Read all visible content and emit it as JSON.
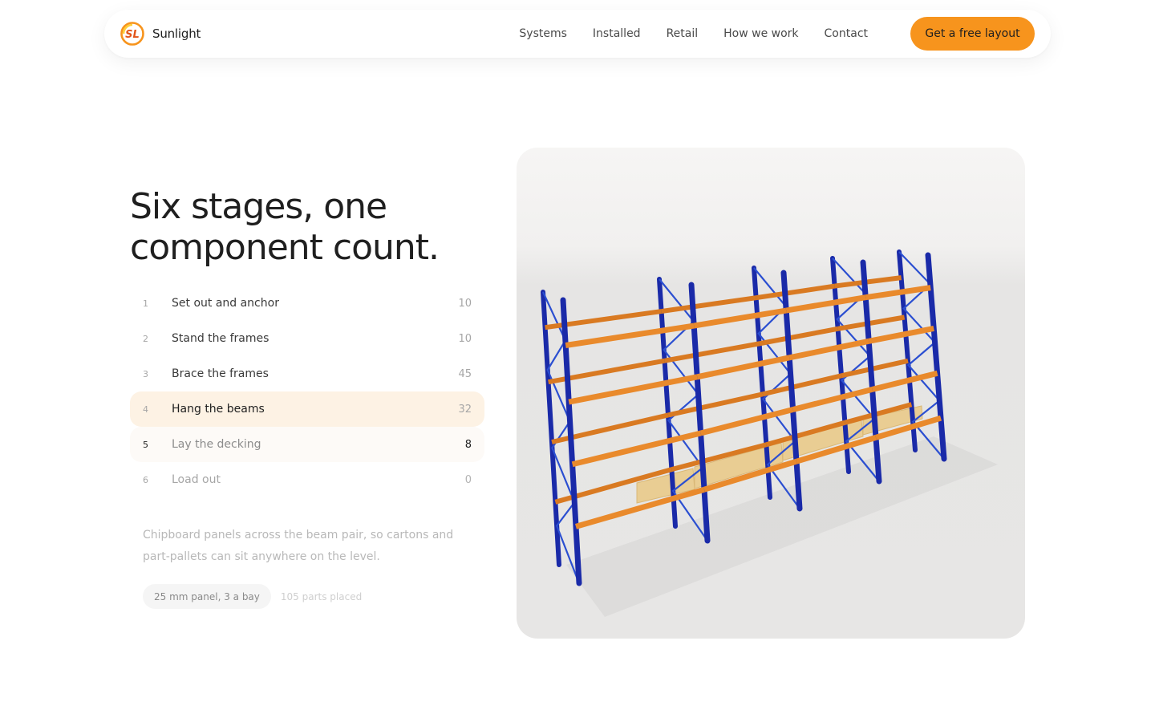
{
  "brand": {
    "name": "Sunlight",
    "logo_text": "SL",
    "logo_icon": "sunlight-logo"
  },
  "nav": {
    "links": [
      "Systems",
      "Installed",
      "Retail",
      "How we work",
      "Contact"
    ],
    "cta": "Get a free layout"
  },
  "headline": "Six stages, one component count.",
  "steps": [
    {
      "num": "1",
      "label": "Set out and anchor",
      "count": "10"
    },
    {
      "num": "2",
      "label": "Stand the frames",
      "count": "10"
    },
    {
      "num": "3",
      "label": "Brace the frames",
      "count": "45"
    },
    {
      "num": "4",
      "label": "Hang the beams",
      "count": "32"
    },
    {
      "num": "5",
      "label": "Lay the decking",
      "count": "8"
    },
    {
      "num": "6",
      "label": "Load out",
      "count": "0"
    }
  ],
  "description": "Chipboard panels across the beam pair, so cartons and part-pallets can sit anywhere on the level.",
  "chip": "25 mm panel, 3 a bay",
  "chip_note": "105 parts placed",
  "colors": {
    "accent": "#f7941d",
    "upright": "#1a2aa8",
    "beam": "#e98a2c",
    "decking": "#e9cd93",
    "active_row": "#fdf2e4"
  },
  "scene": {
    "icon": "pallet-racking-3d-illustration"
  }
}
